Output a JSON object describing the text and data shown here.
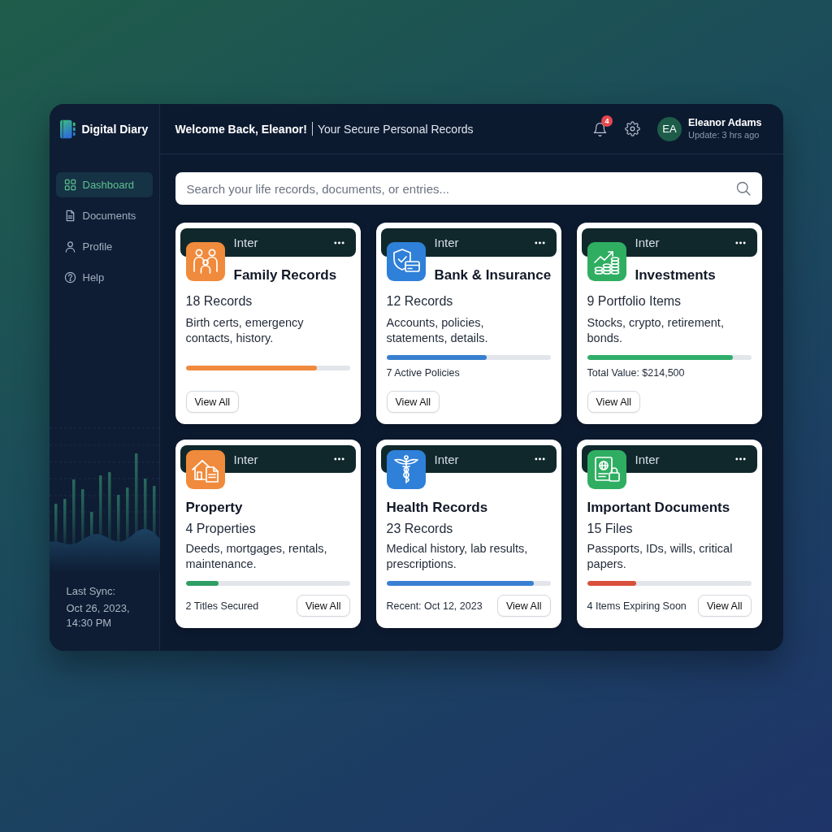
{
  "sidebar": {
    "app_name": "Digital Diary",
    "nav": [
      {
        "kind": "dashboard",
        "label": "Dashboard",
        "selected": true
      },
      {
        "kind": "documents",
        "label": "Documents",
        "selected": false
      },
      {
        "kind": "profile",
        "label": "Profile",
        "selected": false
      },
      {
        "kind": "help",
        "label": "Help",
        "selected": false
      }
    ],
    "last_sync": {
      "label": "Last Sync:",
      "value": "Oct 26, 2023, 14:30 PM"
    }
  },
  "header": {
    "welcome": "Welcome Back, Eleanor!",
    "subtitle": "Your Secure Personal Records",
    "notification_count": "4",
    "user": {
      "initials": "EA",
      "name": "Eleanor Adams",
      "status": "Update: 3 hrs ago"
    }
  },
  "search": {
    "placeholder": "Search your life records, documents, or entries..."
  },
  "cards": [
    {
      "kind": "inline",
      "label": "Inter",
      "icon": {
        "kind": "family",
        "color": "#f08a3c"
      },
      "title": "Family Records",
      "count": "18 Records",
      "description": "Birth certs, emergency contacts, history.",
      "progress": {
        "level": 0.8,
        "color": "#f08a3c"
      },
      "button": "View All"
    },
    {
      "kind": "inline",
      "label": "Inter",
      "icon": {
        "kind": "bank",
        "color": "#2f80d8"
      },
      "title": "Bank & Insurance",
      "count": "12 Records",
      "description": "Accounts, policies, statements, details.",
      "progress": {
        "level": 0.61,
        "color": "#3a7fd0"
      },
      "note": "7 Active Policies",
      "button": "View All"
    },
    {
      "kind": "inline",
      "label": "Inter",
      "icon": {
        "kind": "investments",
        "color": "#2fae62"
      },
      "title": "Investments",
      "count": "9 Portfolio Items",
      "description": "Stocks, crypto, retirement, bonds.",
      "progress": {
        "level": 0.89,
        "color": "#2fae6a"
      },
      "note": "Total Value: $214,500",
      "button": "View All"
    },
    {
      "kind": "stacked",
      "label": "Inter",
      "icon": {
        "kind": "property",
        "color": "#f08a3c"
      },
      "title": "Property",
      "count": "4 Properties",
      "description": "Deeds, mortgages, rentals, maintenance.",
      "progress": {
        "level": 0.2,
        "color": "#2f9e65"
      },
      "note": "2 Titles Secured",
      "button": "View All"
    },
    {
      "kind": "stacked",
      "label": "Inter",
      "icon": {
        "kind": "health",
        "color": "#2f80d8"
      },
      "title": "Health Records",
      "count": "23 Records",
      "description": "Medical history, lab results, prescriptions.",
      "progress": {
        "level": 0.9,
        "color": "#3a80d2"
      },
      "note": "Recent: Oct 12, 2023",
      "button": "View All"
    },
    {
      "kind": "stacked",
      "label": "Inter",
      "icon": {
        "kind": "documents",
        "color": "#2fae62"
      },
      "title": "Important Documents",
      "count": "15 Files",
      "description": "Passports, IDs, wills, critical papers.",
      "progress": {
        "level": 0.3,
        "color": "#d9503c"
      },
      "note": "4 Items Expiring Soon",
      "button": "View All"
    }
  ]
}
